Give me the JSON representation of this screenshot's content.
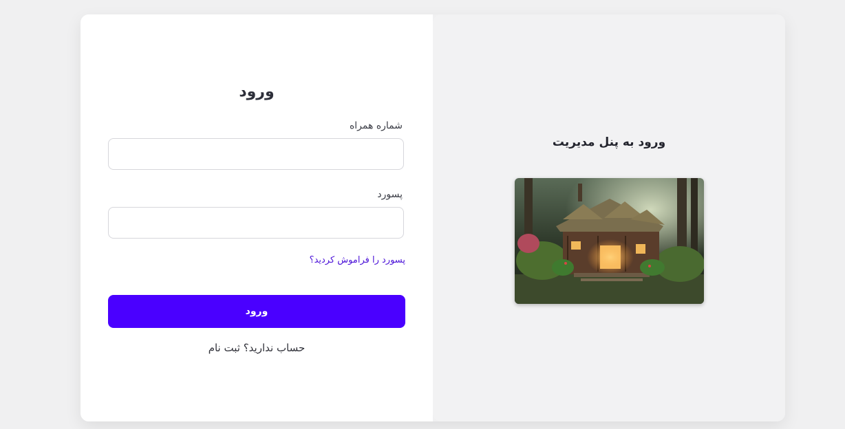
{
  "login": {
    "title": "ورود",
    "phone_label": "شماره همراه",
    "phone_value": "",
    "password_label": "پسورد",
    "password_value": "",
    "forgot_link": "پسورد را فراموش کردید؟",
    "submit_label": "ورود",
    "no_account_text": "حساب ندارید؟",
    "register_link": "ثبت نام"
  },
  "panel": {
    "title": "ورود به پنل مدیریت",
    "image_subject": "cottage-in-forest-illustration"
  },
  "colors": {
    "accent": "#4a00ff",
    "link": "#4b12d8",
    "page_background": "#f0f0f1"
  }
}
